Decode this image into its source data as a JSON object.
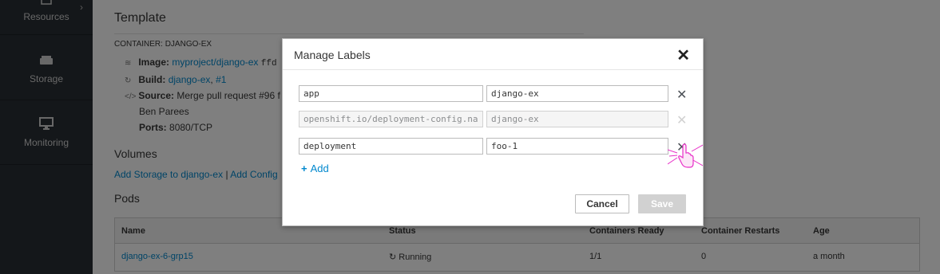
{
  "sidebar": {
    "items": [
      {
        "label": "Resources",
        "icon": "resources-icon"
      },
      {
        "label": "Storage",
        "icon": "storage-icon"
      },
      {
        "label": "Monitoring",
        "icon": "monitoring-icon"
      }
    ]
  },
  "template": {
    "heading": "Template",
    "container_label": "CONTAINER: DJANGO-EX",
    "image_key": "Image:",
    "image_link": "myproject/django-ex",
    "image_hash": "ffd",
    "build_key": "Build:",
    "build_link": "django-ex",
    "build_num": "#1",
    "source_key": "Source:",
    "source_value": "Merge pull request #96 f",
    "source_author": "Ben Parees",
    "ports_key": "Ports:",
    "ports_value": "8080/TCP"
  },
  "volumes": {
    "heading": "Volumes",
    "add_storage": "Add Storage to django-ex",
    "separator": "|",
    "add_config": "Add Config"
  },
  "pods": {
    "heading": "Pods",
    "columns": [
      "Name",
      "Status",
      "Containers Ready",
      "Container Restarts",
      "Age"
    ],
    "rows": [
      {
        "name": "django-ex-6-grp15",
        "status": "Running",
        "ready": "1/1",
        "restarts": "0",
        "age": "a month"
      }
    ]
  },
  "modal": {
    "title": "Manage Labels",
    "labels": [
      {
        "key": "app",
        "value": "django-ex",
        "editable": true
      },
      {
        "key": "openshift.io/deployment-config.name",
        "value": "django-ex",
        "editable": false
      },
      {
        "key": "deployment",
        "value": "foo-1",
        "editable": true
      }
    ],
    "add_label": "Add",
    "cancel_label": "Cancel",
    "save_label": "Save"
  },
  "colors": {
    "link": "#0088ce",
    "sidebar_bg": "#292e34",
    "cursor_accent": "#e830c8"
  }
}
